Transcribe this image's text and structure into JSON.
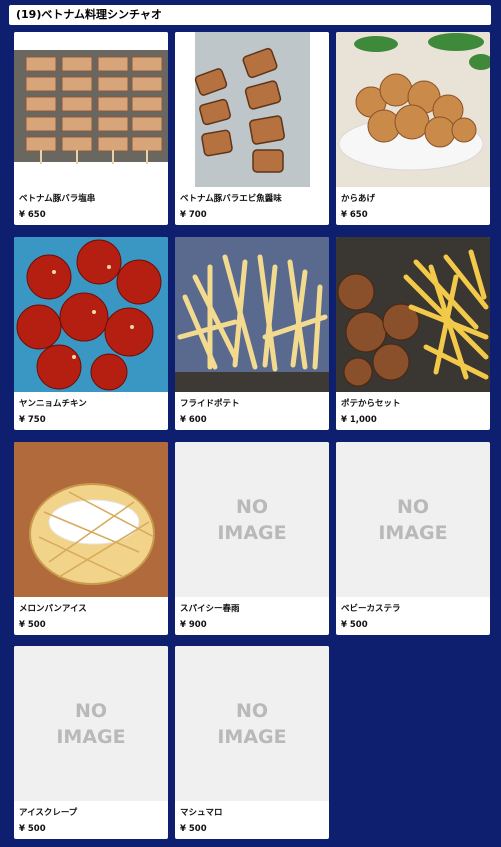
{
  "header": {
    "title": "(19)ベトナム料理シンチャオ"
  },
  "items": [
    {
      "name": "ベトナム豚バラ塩串",
      "price": "¥ 650",
      "image": "pork-skewers"
    },
    {
      "name": "ベトナム豚バラエビ魚醤味",
      "price": "¥ 700",
      "image": "grilled-skewers"
    },
    {
      "name": "からあげ",
      "price": "¥ 650",
      "image": "karaage"
    },
    {
      "name": "ヤンニョムチキン",
      "price": "¥ 750",
      "image": "yangnyeom-chicken"
    },
    {
      "name": "フライドポテト",
      "price": "¥ 600",
      "image": "french-fries"
    },
    {
      "name": "ポテからセット",
      "price": "¥ 1,000",
      "image": "potato-karaage-set"
    },
    {
      "name": "メロンパンアイス",
      "price": "¥ 500",
      "image": "melon-pan"
    },
    {
      "name": "スパイシー春雨",
      "price": "¥ 900",
      "image": "no-image"
    },
    {
      "name": "ベビーカステラ",
      "price": "¥ 500",
      "image": "no-image"
    },
    {
      "name": "アイスクレープ",
      "price": "¥ 500",
      "image": "no-image"
    },
    {
      "name": "マシュマロ",
      "price": "¥ 500",
      "image": "no-image"
    }
  ],
  "placeholder": {
    "line1": "NO",
    "line2": "IMAGE"
  },
  "colors": {
    "background": "#0d1f6e",
    "card": "#ffffff",
    "placeholder_bg": "#f0f0f0",
    "placeholder_text": "#b9b9b9"
  }
}
